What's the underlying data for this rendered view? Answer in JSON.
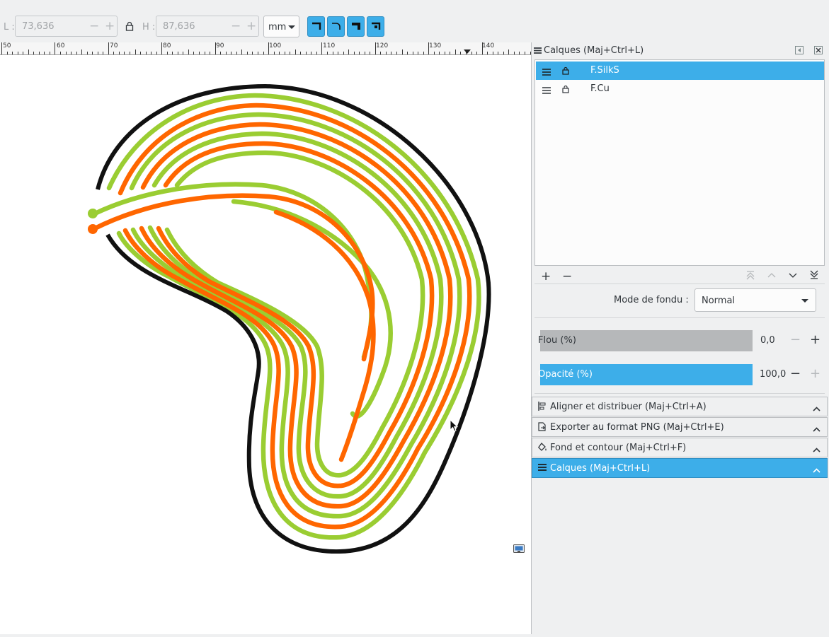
{
  "toolbar": {
    "width_label": "L :",
    "width_value": "73,636",
    "height_label": "H :",
    "height_value": "87,636",
    "minus": "−",
    "plus": "+",
    "unit": "mm"
  },
  "ruler": {
    "labels": [
      "50",
      "60",
      "70",
      "80",
      "90",
      "100",
      "110",
      "120",
      "130",
      "140"
    ]
  },
  "layers_panel": {
    "title": "Calques (Maj+Ctrl+L)",
    "layers": [
      {
        "name": "F.SilkS",
        "selected": true
      },
      {
        "name": "F.Cu",
        "selected": false
      }
    ],
    "add": "+",
    "remove": "−",
    "blend_label": "Mode de fondu :",
    "blend_value": "Normal",
    "blur_label": "Flou (%)",
    "blur_value": "0,0",
    "opacity_label": "Opacité (%)",
    "opacity_value": "100,0",
    "blur_fraction": 0.0,
    "opacity_fraction": 1.0
  },
  "docks": [
    {
      "label": "Aligner et distribuer (Maj+Ctrl+A)",
      "icon": "align-icon",
      "active": false
    },
    {
      "label": "Exporter au format PNG (Maj+Ctrl+E)",
      "icon": "export-icon",
      "active": false
    },
    {
      "label": "Fond et contour (Maj+Ctrl+F)",
      "icon": "fill-stroke-icon",
      "active": false
    },
    {
      "label": "Calques (Maj+Ctrl+L)",
      "icon": "layers-icon",
      "active": true
    }
  ],
  "colors": {
    "accent": "#3daee9",
    "outline": "#111111",
    "green_track": "#9acd32",
    "orange_track": "#ff6600"
  }
}
